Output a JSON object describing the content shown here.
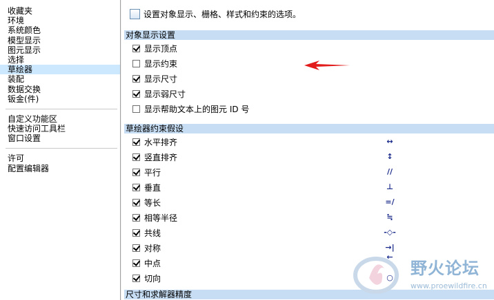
{
  "sidebar": {
    "group1": [
      "收藏夹",
      "环境",
      "系统颜色",
      "模型显示",
      "图元显示",
      "选择",
      "草绘器",
      "装配",
      "数据交换",
      "钣金件)"
    ],
    "group1_sheet_metal": "钣金(件)",
    "group2": [
      "自定义功能区",
      "快速访问工具栏",
      "窗口设置"
    ],
    "group3": [
      "许可",
      "配置编辑器"
    ],
    "selected": "草绘器"
  },
  "header": {
    "text": "设置对象显示、栅格、样式和约束的选项。"
  },
  "sections": {
    "display": {
      "title": "对象显示设置",
      "options": [
        {
          "label": "显示顶点",
          "checked": true
        },
        {
          "label": "显示约束",
          "checked": false
        },
        {
          "label": "显示尺寸",
          "checked": true
        },
        {
          "label": "显示弱尺寸",
          "checked": true
        },
        {
          "label": "显示帮助文本上的图元 ID 号",
          "checked": false
        }
      ]
    },
    "constraints": {
      "title": "草绘器约束假设",
      "options": [
        {
          "label": "水平排齐",
          "checked": true,
          "symbol": "↔"
        },
        {
          "label": "竖直排齐",
          "checked": true,
          "symbol": "↕"
        },
        {
          "label": "平行",
          "checked": true,
          "symbol": "//"
        },
        {
          "label": "垂直",
          "checked": true,
          "symbol": "⊥"
        },
        {
          "label": "等长",
          "checked": true,
          "symbol": "=/"
        },
        {
          "label": "相等半径",
          "checked": true,
          "symbol": "≒"
        },
        {
          "label": "共线",
          "checked": true,
          "symbol": "-◇-"
        },
        {
          "label": "对称",
          "checked": true,
          "symbol": "→|←"
        },
        {
          "label": "中点",
          "checked": true,
          "symbol": "↘"
        },
        {
          "label": "切向",
          "checked": true,
          "symbol": "○"
        }
      ]
    },
    "precision": {
      "title": "尺寸和求解器精度"
    }
  },
  "watermark": {
    "text": "野火论坛",
    "url": "www.proewildfire.cn"
  },
  "colors": {
    "selected": "#cce8ff",
    "section": "#c6ddf3",
    "arrow": "#e21b1b"
  }
}
